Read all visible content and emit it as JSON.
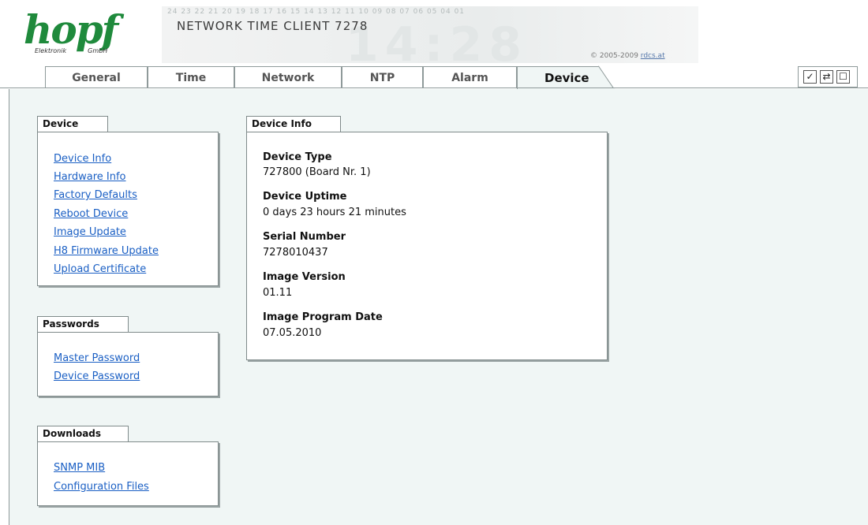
{
  "header": {
    "logo_text": "hopf",
    "logo_sub_left": "Elektronik",
    "logo_sub_right": "GmbH",
    "digit_strip": "24 23 22 21 20 19 18 17 16 15 14 13 12 11 10 09 08 07 06 05 04 01",
    "ghost_clock": "14:28",
    "product_title": "NETWORK TIME CLIENT 7278",
    "copyright_prefix": "© 2005-2009",
    "copyright_link": "rdcs.at"
  },
  "tabs": [
    {
      "label": "General",
      "active": false
    },
    {
      "label": "Time",
      "active": false
    },
    {
      "label": "Network",
      "active": false
    },
    {
      "label": "NTP",
      "active": false
    },
    {
      "label": "Alarm",
      "active": false
    },
    {
      "label": "Device",
      "active": true
    }
  ],
  "toolbar": {
    "apply_icon": "check-icon",
    "reload_icon": "swap-arrows-icon",
    "save_icon": "square-icon",
    "apply_glyph": "✓",
    "reload_glyph": "⇄",
    "save_glyph": "☐"
  },
  "sidebar": {
    "device": {
      "title": "Device",
      "links": [
        "Device Info",
        "Hardware Info",
        "Factory Defaults",
        "Reboot Device",
        "Image Update",
        "H8 Firmware Update",
        "Upload Certificate"
      ]
    },
    "passwords": {
      "title": "Passwords",
      "links": [
        "Master Password",
        "Device Password"
      ]
    },
    "downloads": {
      "title": "Downloads",
      "links": [
        "SNMP MIB",
        "Configuration Files"
      ]
    }
  },
  "device_info": {
    "title": "Device Info",
    "fields": [
      {
        "label": "Device Type",
        "value": "727800 (Board Nr. 1)"
      },
      {
        "label": "Device Uptime",
        "value": "0 days 23 hours 21 minutes"
      },
      {
        "label": "Serial Number",
        "value": "7278010437"
      },
      {
        "label": "Image Version",
        "value": "01.11"
      },
      {
        "label": "Image Program Date",
        "value": "07.05.2010"
      }
    ]
  },
  "colors": {
    "brand_green": "#1f8a3c",
    "link_blue": "#1a5fc4",
    "content_bg": "#f0f6f5"
  }
}
